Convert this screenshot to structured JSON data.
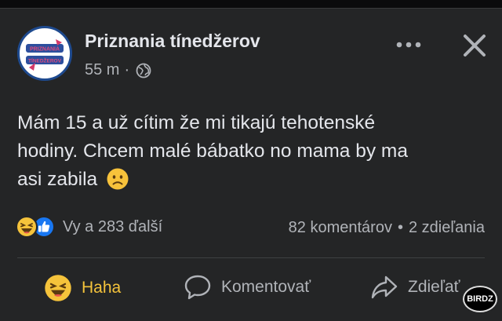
{
  "post": {
    "author": "Priznania tínedžerov",
    "time": "55 m",
    "privacy_icon": "globe-icon",
    "text_lines": [
      "Mám 15 a už cítim že mi tikajú tehotenské",
      "hodiny. Chcem malé bábatko no mama by ma",
      "asi zabila"
    ],
    "text_emoji": "sad-face-emoji"
  },
  "avatar": {
    "logo_top": "PRIZNANIA",
    "logo_bottom": "TÍNEDŽEROV"
  },
  "reactions": {
    "icons": [
      "haha-icon",
      "like-icon"
    ],
    "summary": "Vy a 283 ďalší",
    "comments": "82 komentárov",
    "separator": "•",
    "shares": "2 zdieľania"
  },
  "actions": {
    "haha": "Haha",
    "comment": "Komentovať",
    "share": "Zdieľať"
  },
  "watermark": "BIRDZ",
  "colors": {
    "background": "#242526",
    "text": "#e4e6eb",
    "secondary": "#b0b3b8",
    "haha_accent": "#f5c33b",
    "like_blue": "#1877f2"
  }
}
